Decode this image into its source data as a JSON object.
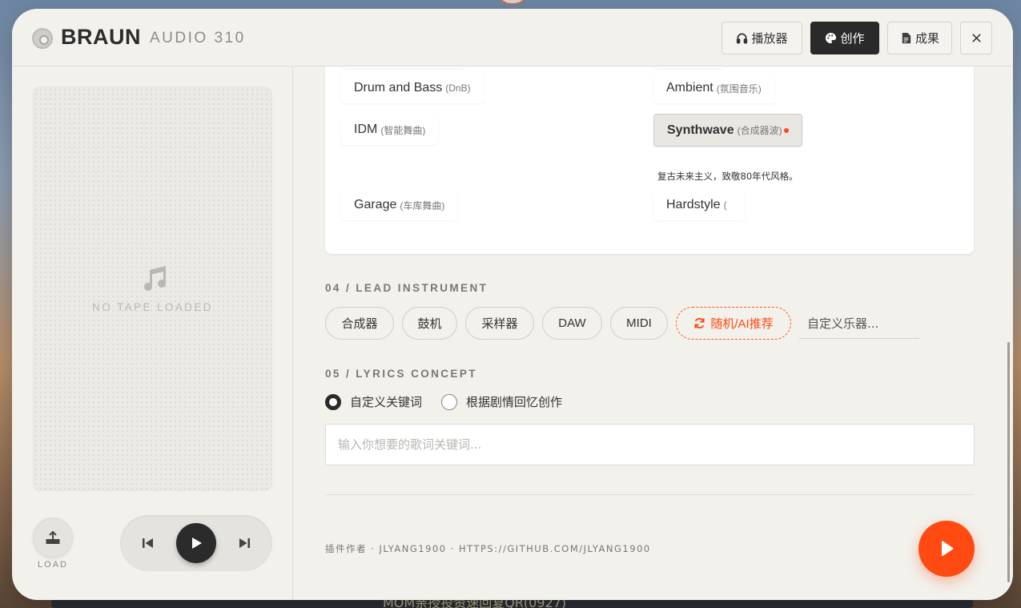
{
  "background": {
    "taskbar_text": "MOM亲授投资速回复QR(0927)"
  },
  "header": {
    "brand": "BRAUN",
    "model": "AUDIO 310",
    "tabs": [
      {
        "label": "播放器",
        "icon": "headphones-icon",
        "active": false
      },
      {
        "label": "创作",
        "icon": "palette-icon",
        "active": true
      },
      {
        "label": "成果",
        "icon": "document-icon",
        "active": false
      }
    ],
    "close_icon": "close-icon"
  },
  "left_panel": {
    "tape_status": "NO TAPE LOADED",
    "load_label": "LOAD"
  },
  "genres": [
    {
      "name": "Drum and Bass",
      "sub": "(DnB)"
    },
    {
      "name": "Ambient",
      "sub": "(氛围音乐)"
    },
    {
      "name": "IDM",
      "sub": "(智能舞曲)"
    },
    {
      "name": "Synthwave",
      "sub": "(合成器波)",
      "selected": true
    },
    {
      "name": "Garage",
      "sub": "(车库舞曲)"
    },
    {
      "name": "Hardstyle",
      "sub": "("
    }
  ],
  "selected_genre_description": "复古未来主义，致敬80年代风格。",
  "lead_instrument": {
    "section_label": "04 / LEAD INSTRUMENT",
    "options": [
      "合成器",
      "鼓机",
      "采样器",
      "DAW",
      "MIDI"
    ],
    "random_label": "随机/AI推荐",
    "custom_placeholder": "自定义乐器..."
  },
  "lyrics": {
    "section_label": "05 / LYRICS CONCEPT",
    "modes": [
      {
        "label": "自定义关键词",
        "selected": true
      },
      {
        "label": "根据剧情回忆创作",
        "selected": false
      }
    ],
    "input_placeholder": "输入你想要的歌词关键词..."
  },
  "footer": {
    "credit": "插件作者 · JLYANG1900 · HTTPS://GITHUB.COM/JLYANG1900"
  },
  "colors": {
    "accent": "#ff4a12",
    "dark": "#2a2a2a",
    "panel_bg": "#f2f1ec"
  }
}
